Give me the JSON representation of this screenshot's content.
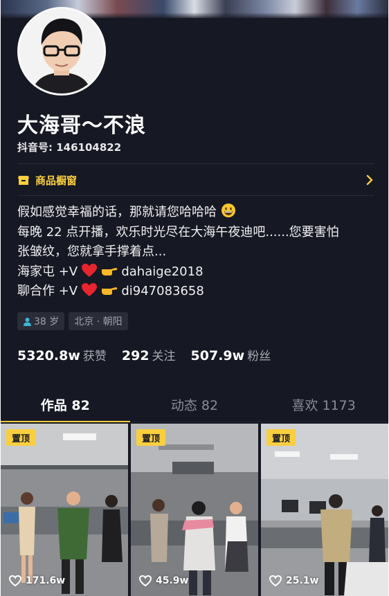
{
  "profile": {
    "nickname": "大海哥～不浪",
    "douyin_id": "抖音号: 146104822"
  },
  "shop": {
    "label": "商品橱窗",
    "icon": "shop-icon"
  },
  "bio": {
    "line1": "假如感觉幸福的话，那就请您哈哈哈",
    "line2": "每晚 22 点开播，欢乐时光尽在大海午夜迪吧......您要害怕",
    "line3": "张皱纹，您就拿手撑着点...",
    "line4_prefix": "海家屯 +V",
    "line4_handle": "dahaige2018",
    "line5_prefix": "聊合作 +V",
    "line5_handle": "di947083658"
  },
  "tags": {
    "age": "38 岁",
    "location": "北京 · 朝阳"
  },
  "stats": [
    {
      "value": "5320.8w",
      "label": "获赞"
    },
    {
      "value": "292",
      "label": "关注"
    },
    {
      "value": "507.9w",
      "label": "粉丝"
    }
  ],
  "tabs": [
    {
      "label": "作品 82",
      "active": true
    },
    {
      "label": "动态 82",
      "active": false
    },
    {
      "label": "喜欢 1173",
      "active": false
    }
  ],
  "videos": [
    {
      "badge": "置顶",
      "likes": "171.6w"
    },
    {
      "badge": "置顶",
      "likes": "45.9w"
    },
    {
      "badge": "置顶",
      "likes": "25.1w"
    }
  ],
  "colors": {
    "accent": "#facf3f",
    "background": "#161823",
    "heart": "#e8242e"
  }
}
